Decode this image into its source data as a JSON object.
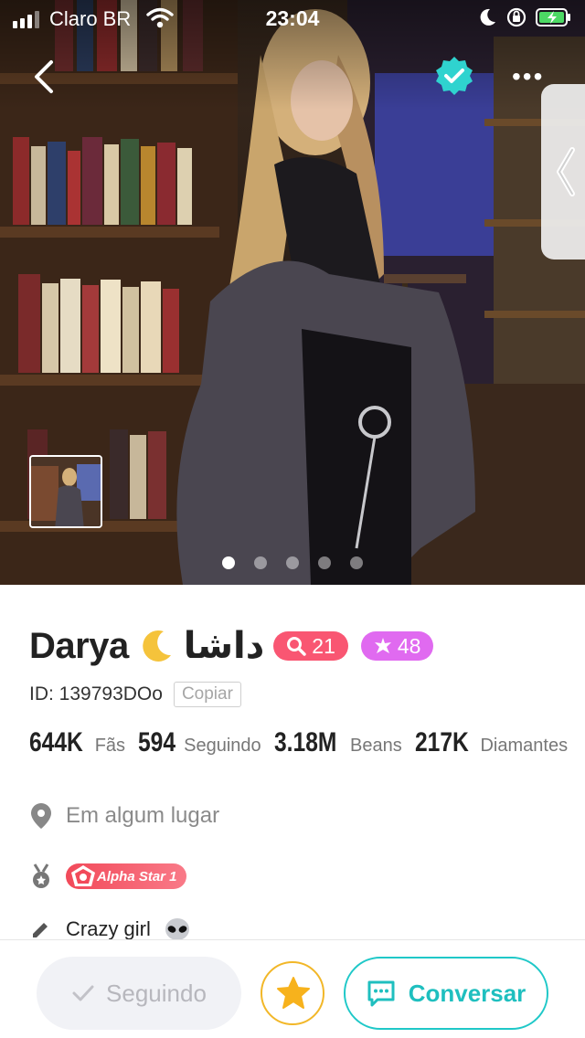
{
  "status_bar": {
    "carrier": "Claro BR",
    "time": "23:04"
  },
  "photo": {
    "page_count": 5,
    "active_page": 1
  },
  "profile": {
    "name": "Darya",
    "name_arabic": "داشا",
    "level_badge": "21",
    "star_badge": "48",
    "id_label": "ID: 139793DOo",
    "copy_label": "Copiar",
    "stats": [
      {
        "value": "644K",
        "label": "Fãs"
      },
      {
        "value": "594",
        "label": "Seguindo"
      },
      {
        "value": "3.18M",
        "label": "Beans"
      },
      {
        "value": "217K",
        "label": "Diamantes"
      }
    ],
    "location": "Em algum lugar",
    "medal": "Alpha Star 1",
    "bio": "Crazy girl"
  },
  "actions": {
    "following_label": "Seguindo",
    "chat_label": "Conversar"
  },
  "colors": {
    "accent_teal": "#1fc8c8",
    "level_red": "#f95672",
    "star_purple": "#e06af0",
    "favorite_gold": "#f2b728",
    "verified_teal": "#2fd3cf"
  },
  "icons": [
    "back-arrow-icon",
    "verified-icon",
    "more-icon",
    "side-tab-chevron-icon",
    "location-pin-icon",
    "medal-icon",
    "pencil-icon",
    "check-icon",
    "star-icon",
    "chat-icon",
    "moon-emoji-icon",
    "alien-emoji-icon"
  ]
}
